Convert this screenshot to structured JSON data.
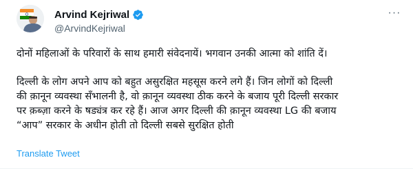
{
  "author": {
    "display_name": "Arvind Kejriwal",
    "handle": "@ArvindKejriwal",
    "verified": true,
    "verified_icon": "verified-badge-icon",
    "avatar_icon": "profile-avatar",
    "more_icon": "more-options-icon"
  },
  "tweet": {
    "paragraph1": "दोनों महिलाओं के परिवारों के साथ हमारी संवेदनायें। भगवान उनकी आत्मा को शांति दें।",
    "paragraph2_lines": [
      "दिल्ली के लोग अपने आप को बहुत असुरक्षित महसूस करने लगे हैं। जिन लोगों को दिल्ली",
      "की क़ानून व्यवस्था सँभालनी है, वो क़ानून व्यवस्था ठीक करने के बजाय पूरी दिल्ली सरकार",
      "पर क़ब्ज़ा करने के षड्यंत्र कर रहे हैं। आज अगर दिल्ली की क़ानून व्यवस्था LG की बजाय",
      "“आप” सरकार के अधीन होती तो दिल्ली सबसे सुरक्षित होती"
    ]
  },
  "actions": {
    "translate_label": "Translate Tweet"
  },
  "colors": {
    "text": "#0f1419",
    "secondary": "#536471",
    "link": "#1d9bf0",
    "verified": "#1d9bf0",
    "divider": "#eff3f4"
  }
}
